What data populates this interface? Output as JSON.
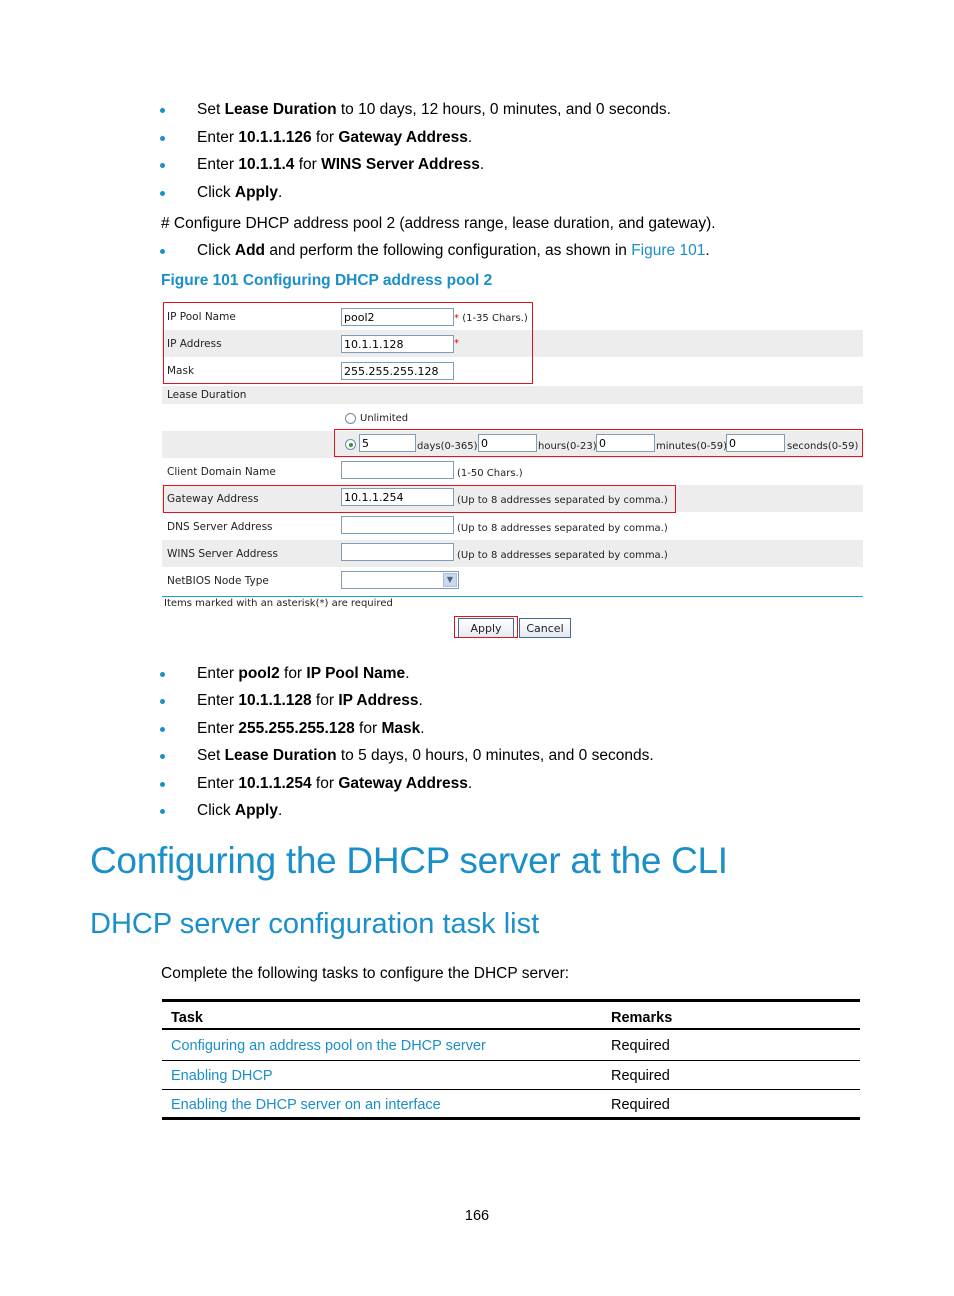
{
  "top_bullets": [
    {
      "parts": [
        [
          "Set ",
          false
        ],
        [
          "Lease Duration",
          true
        ],
        [
          " to 10 days, 12 hours, 0 minutes, and 0 seconds.",
          false
        ]
      ]
    },
    {
      "parts": [
        [
          "Enter ",
          false
        ],
        [
          "10.1.1.126",
          true
        ],
        [
          " for ",
          false
        ],
        [
          "Gateway Address",
          true
        ],
        [
          ".",
          false
        ]
      ]
    },
    {
      "parts": [
        [
          "Enter ",
          false
        ],
        [
          "10.1.1.4",
          true
        ],
        [
          " for ",
          false
        ],
        [
          "WINS Server Address",
          true
        ],
        [
          ".",
          false
        ]
      ]
    },
    {
      "parts": [
        [
          "Click ",
          false
        ],
        [
          "Apply",
          true
        ],
        [
          ".",
          false
        ]
      ]
    }
  ],
  "configure_para": "# Configure DHCP address pool 2 (address range, lease duration, and gateway).",
  "add_bullet": {
    "prefix": "Click ",
    "bold": "Add",
    "middle": " and perform the following configuration, as shown in ",
    "link": "Figure 101",
    "suffix": "."
  },
  "figure": {
    "caption": "Figure 101 Configuring DHCP address pool 2",
    "fields": {
      "ip_pool_name": {
        "label": "IP Pool Name",
        "value": "pool2",
        "required": "*",
        "hint": "(1-35 Chars.)"
      },
      "ip_address": {
        "label": "IP Address",
        "value": "10.1.1.128",
        "required": "*"
      },
      "mask": {
        "label": "Mask",
        "value": "255.255.255.128"
      },
      "lease_duration": {
        "label": "Lease Duration",
        "unlimited_label": "Unlimited",
        "unlimited_selected": false,
        "custom_selected": true,
        "days": "5",
        "days_label": "days(0-365)",
        "hours": "0",
        "hours_label": "hours(0-23)",
        "minutes": "0",
        "minutes_label": "minutes(0-59)",
        "seconds": "0",
        "seconds_label": "seconds(0-59)"
      },
      "client_domain_name": {
        "label": "Client Domain Name",
        "value": "",
        "hint": "(1-50 Chars.)"
      },
      "gateway_address": {
        "label": "Gateway Address",
        "value": "10.1.1.254",
        "hint": "(Up to 8 addresses separated by comma.)"
      },
      "dns_server_address": {
        "label": "DNS Server Address",
        "value": "",
        "hint": "(Up to 8 addresses separated by comma.)"
      },
      "wins_server_address": {
        "label": "WINS Server Address",
        "value": "",
        "hint": "(Up to 8 addresses separated by comma.)"
      },
      "netbios_node_type": {
        "label": "NetBIOS Node Type",
        "value": ""
      }
    },
    "required_note": "Items marked with an asterisk(*) are required",
    "apply_label": "Apply",
    "cancel_label": "Cancel"
  },
  "steps_bullets": [
    {
      "parts": [
        [
          "Enter ",
          false
        ],
        [
          "pool2",
          true
        ],
        [
          " for ",
          false
        ],
        [
          "IP Pool Name",
          true
        ],
        [
          ".",
          false
        ]
      ]
    },
    {
      "parts": [
        [
          "Enter ",
          false
        ],
        [
          "10.1.1.128",
          true
        ],
        [
          " for ",
          false
        ],
        [
          "IP Address",
          true
        ],
        [
          ".",
          false
        ]
      ]
    },
    {
      "parts": [
        [
          "Enter ",
          false
        ],
        [
          "255.255.255.128",
          true
        ],
        [
          " for ",
          false
        ],
        [
          "Mask",
          true
        ],
        [
          ".",
          false
        ]
      ]
    },
    {
      "parts": [
        [
          "Set ",
          false
        ],
        [
          "Lease Duration",
          true
        ],
        [
          " to 5 days, 0 hours, 0 minutes, and 0 seconds.",
          false
        ]
      ]
    },
    {
      "parts": [
        [
          "Enter ",
          false
        ],
        [
          "10.1.1.254",
          true
        ],
        [
          " for ",
          false
        ],
        [
          "Gateway Address",
          true
        ],
        [
          ".",
          false
        ]
      ]
    },
    {
      "parts": [
        [
          "Click ",
          false
        ],
        [
          "Apply",
          true
        ],
        [
          ".",
          false
        ]
      ]
    }
  ],
  "heading1": "Configuring the DHCP server at the CLI",
  "heading2": "DHCP server configuration task list",
  "intro": "Complete the following tasks to configure the DHCP server:",
  "task_table": {
    "headers": [
      "Task",
      "Remarks"
    ],
    "rows": [
      {
        "task": "Configuring an address pool on the DHCP server",
        "remarks": "Required"
      },
      {
        "task": "Enabling DHCP",
        "remarks": "Required"
      },
      {
        "task": "Enabling the DHCP server on an interface",
        "remarks": "Required"
      }
    ]
  },
  "page_number": "166",
  "colors": {
    "accent": "#1a8fc9",
    "highlight_box": "#e0141e",
    "row_gray": "#ededed"
  }
}
